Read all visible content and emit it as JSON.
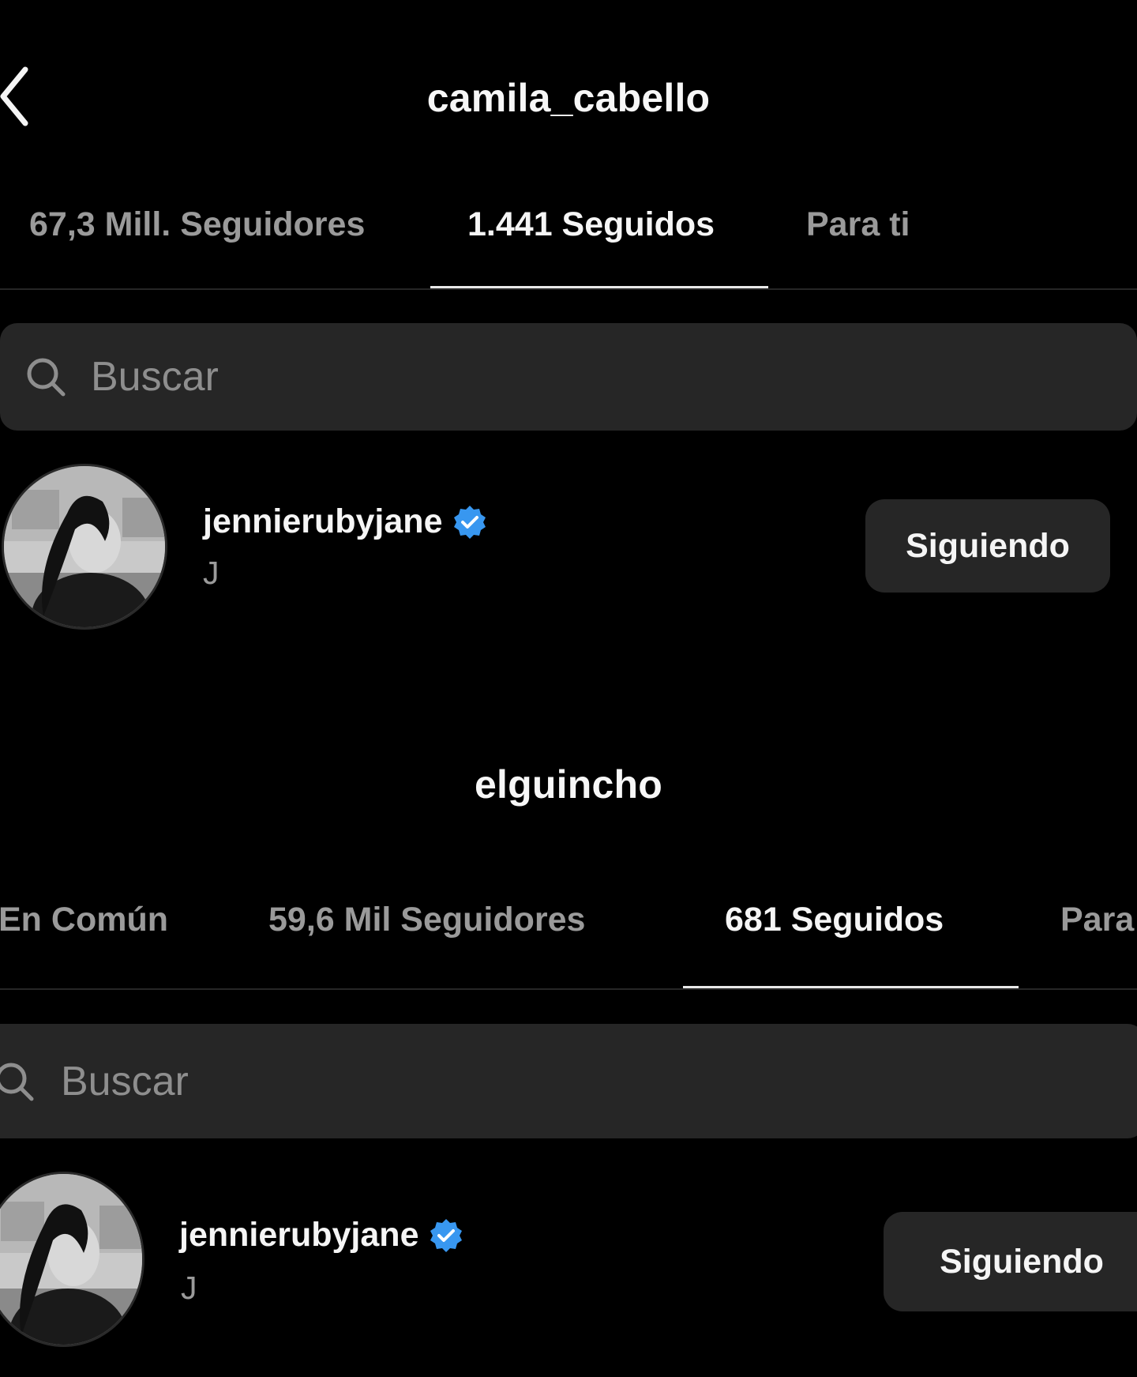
{
  "panels": [
    {
      "title": "camila_cabello",
      "tabs": [
        {
          "label": "67,3 Mill. Seguidores",
          "active": false
        },
        {
          "label": "1.441 Seguidos",
          "active": true
        },
        {
          "label": "Para ti",
          "active": false
        }
      ],
      "search": {
        "placeholder": "Buscar",
        "value": ""
      },
      "user": {
        "username": "jennierubyjane",
        "verified": true,
        "full_name": "J",
        "button_label": "Siguiendo"
      }
    },
    {
      "title": "elguincho",
      "tabs": [
        {
          "label": "En Común",
          "active": false
        },
        {
          "label": "59,6 Mil Seguidores",
          "active": false
        },
        {
          "label": "681 Seguidos",
          "active": true
        },
        {
          "label": "Para ti",
          "active": false
        }
      ],
      "search": {
        "placeholder": "Buscar",
        "value": ""
      },
      "user": {
        "username": "jennierubyjane",
        "verified": true,
        "full_name": "J",
        "button_label": "Siguiendo"
      }
    }
  ],
  "icons": {
    "back": "chevron-left-icon",
    "search": "search-icon",
    "verified": "verified-badge-icon",
    "avatar": "avatar"
  },
  "colors": {
    "background": "#000000",
    "surface": "#262626",
    "text_primary": "#f5f5f5",
    "text_secondary": "#9a9a9a",
    "verified_blue": "#3897f0"
  }
}
